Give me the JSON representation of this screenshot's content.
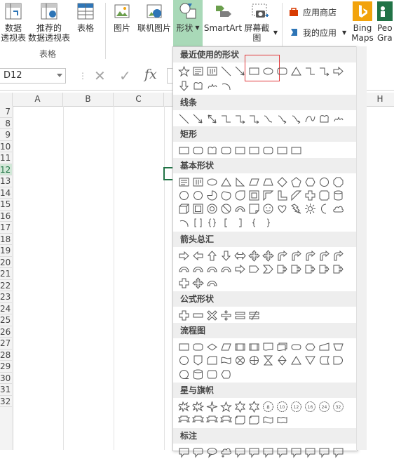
{
  "ribbon": {
    "pivot_label_1": "数据",
    "pivot_label_2": "透视表",
    "rec_pivot_label_1": "推荐的",
    "rec_pivot_label_2": "数据透视表",
    "table_label": "表格",
    "table_group": "表格",
    "picture_label": "图片",
    "online_picture_label": "联机图片",
    "shapes_label": "形状",
    "smartart_label": "SmartArt",
    "screenshot_label": "屏幕截图",
    "store_label": "应用商店",
    "myapps_label": "我的应用",
    "bing_label_1": "Bing",
    "bing_label_2": "Maps",
    "people_label_1": "Peo",
    "people_label_2": "Gra"
  },
  "formula_bar": {
    "name_box": "D12",
    "fx": "fx"
  },
  "sheet": {
    "columns": [
      "A",
      "B",
      "C"
    ],
    "last_col": "H",
    "rows": [
      "7",
      "8",
      "9",
      "10",
      "11",
      "12",
      "13",
      "14",
      "15",
      "16",
      "17",
      "18",
      "19",
      "20",
      "21",
      "22",
      "23",
      "24",
      "25",
      "26",
      "27",
      "28",
      "29",
      "30",
      "31",
      "32"
    ],
    "selected_row": "12"
  },
  "shapes_panel": {
    "sections": [
      {
        "title": "最近使用的形状"
      },
      {
        "title": "线条"
      },
      {
        "title": "矩形"
      },
      {
        "title": "基本形状"
      },
      {
        "title": "箭头总汇"
      },
      {
        "title": "公式形状"
      },
      {
        "title": "流程图"
      },
      {
        "title": "星与旗帜"
      },
      {
        "title": "标注"
      }
    ]
  },
  "colors": {
    "accent": "#217346",
    "active_tab": "#a9d9b8",
    "highlight": "#e0383a",
    "store_red": "#d83b01",
    "bing_orange": "#f2a30c"
  }
}
